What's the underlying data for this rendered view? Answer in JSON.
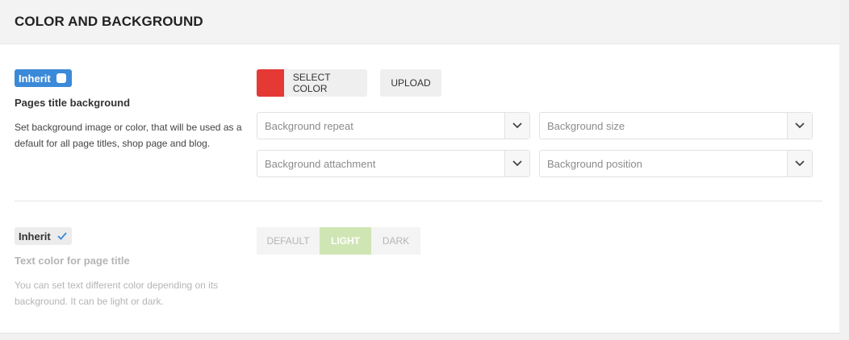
{
  "section": {
    "title": "COLOR AND BACKGROUND"
  },
  "bg_field": {
    "inherit_label": "Inherit",
    "title": "Pages title background",
    "description": "Set background image or color, that will be used as a default for all page titles, shop page and blog.",
    "select_color_label": "SELECT COLOR",
    "selected_color": "#e53935",
    "upload_label": "UPLOAD",
    "selects": [
      {
        "placeholder": "Background repeat"
      },
      {
        "placeholder": "Background size"
      },
      {
        "placeholder": "Background attachment"
      },
      {
        "placeholder": "Background position"
      }
    ]
  },
  "text_color_field": {
    "inherit_label": "Inherit",
    "inherit_checked": true,
    "title": "Text color for page title",
    "description": "You can set text different color depending on its background. It can be light or dark.",
    "options": [
      {
        "label": "DEFAULT"
      },
      {
        "label": "LIGHT",
        "selected": true
      },
      {
        "label": "DARK"
      }
    ]
  },
  "colors": {
    "accent": "#3b8ad9",
    "selected_option": "#cfe6b4"
  },
  "icons": {
    "dropdown": "chevron-down-icon",
    "check": "check-icon"
  }
}
